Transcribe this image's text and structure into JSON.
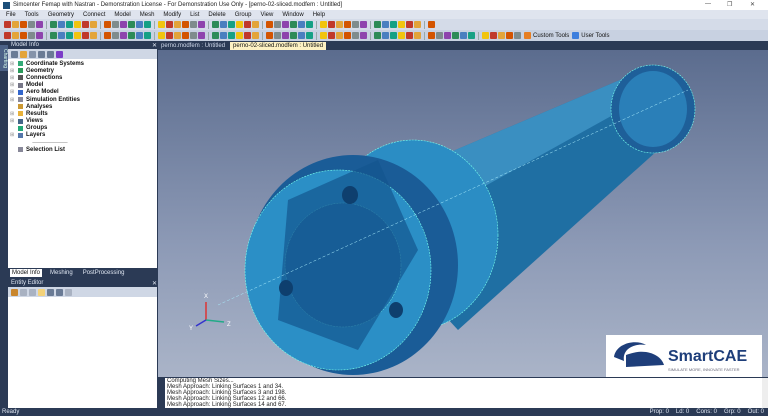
{
  "title": "Simcenter Femap with Nastran - Demonstration License - For Demonstration Use Only - [perno-02-sliced.modfem : Untitled]",
  "window_controls": {
    "minimize": "—",
    "restore": "❐",
    "close": "✕"
  },
  "menu": [
    "File",
    "Tools",
    "Geometry",
    "Connect",
    "Model",
    "Mesh",
    "Modify",
    "List",
    "Delete",
    "Group",
    "View",
    "Window",
    "Help"
  ],
  "toolbar": {
    "custom_tools": "Custom Tools",
    "user_tools": "User Tools"
  },
  "side_tab": "Charting",
  "model_info": {
    "title": "Model Info",
    "items": [
      "Coordinate Systems",
      "Geometry",
      "Connections",
      "Model",
      "Aero Model",
      "Simulation Entities",
      "Analyses",
      "Results",
      "Views",
      "Groups",
      "Layers"
    ],
    "selection_list": "Selection List"
  },
  "panel_tabs": [
    "Model Info",
    "Meshing",
    "PostProcessing"
  ],
  "entity_editor": {
    "title": "Entity Editor"
  },
  "doc_tabs": [
    "perno.modfem : Untitled",
    "perno-02-sliced.modfem : Untitled"
  ],
  "axes": {
    "x": "X",
    "y": "Y",
    "z": "Z"
  },
  "logo": {
    "name": "SmartCAE",
    "tagline": "SIMULATE MORE, INNOVATE FASTER"
  },
  "messages": [
    "Computing Mesh Sizes...",
    "Mesh Approach: Linking Surfaces 1 and 34.",
    "Mesh Approach: Linking Surfaces 3 and 198.",
    "Mesh Approach: Linking Surfaces 12 and 66.",
    "Mesh Approach: Linking Surfaces 14 and 67."
  ],
  "status": {
    "left": "Ready",
    "prop": "Prop: 0",
    "ld": "Ld: 0",
    "cons": "Cons: 0",
    "grp": "Grp: 0",
    "out": "Out: 0"
  }
}
